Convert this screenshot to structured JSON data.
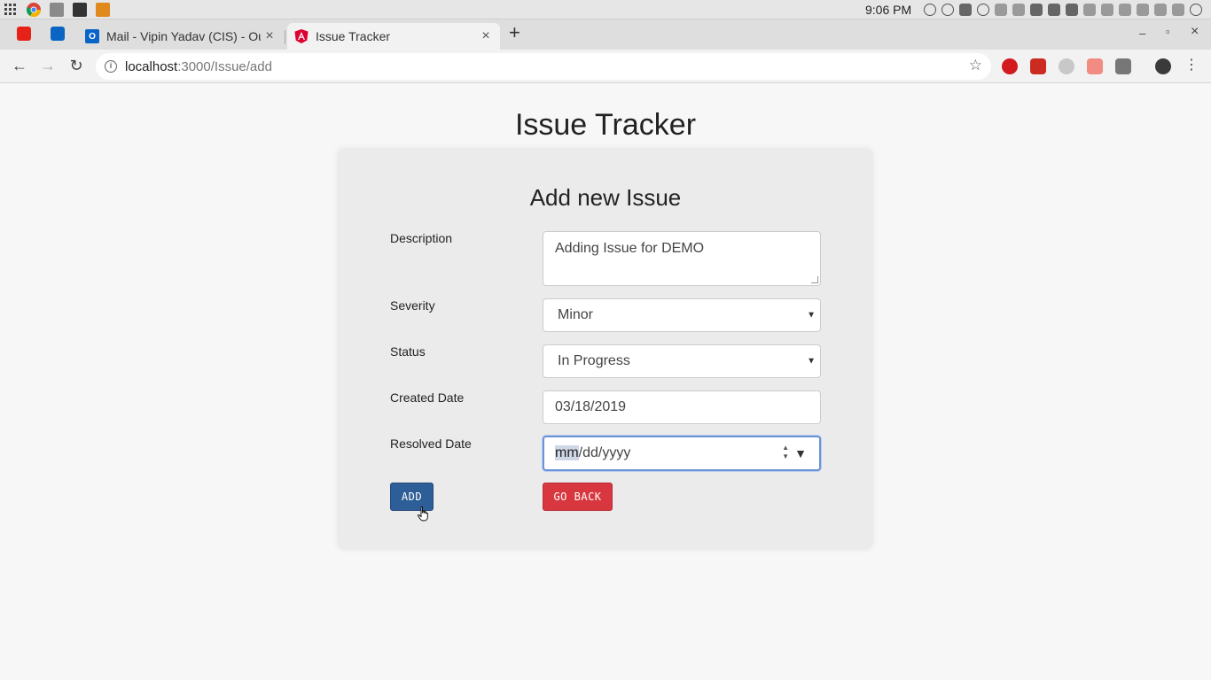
{
  "os": {
    "clock": "9:06 PM"
  },
  "browser": {
    "tabs": [
      {
        "title": "Mail - Vipin Yadav (CIS) - Outl",
        "active": false
      },
      {
        "title": "Issue Tracker",
        "active": true
      }
    ],
    "tab_close_glyph": "×",
    "new_tab_glyph": "+",
    "address": {
      "host": "localhost",
      "path": ":3000/Issue/add"
    },
    "info_glyph": "i",
    "star_glyph": "☆"
  },
  "page": {
    "app_title": "Issue Tracker",
    "form_title": "Add new Issue",
    "fields": {
      "description": {
        "label": "Description",
        "value": "Adding Issue for DEMO"
      },
      "severity": {
        "label": "Severity",
        "value": "Minor"
      },
      "status": {
        "label": "Status",
        "value": "In Progress"
      },
      "created_date": {
        "label": "Created Date",
        "value": "03/18/2019"
      },
      "resolved_date": {
        "label": "Resolved Date",
        "placeholder_mm": "mm",
        "placeholder_rest": "/dd/yyyy"
      }
    },
    "buttons": {
      "add": "ADD",
      "go_back": "GO BACK"
    }
  },
  "colors": {
    "add_button": "#2e5e97",
    "go_back_button": "#d9373f",
    "focus_border": "#6b93d6"
  }
}
